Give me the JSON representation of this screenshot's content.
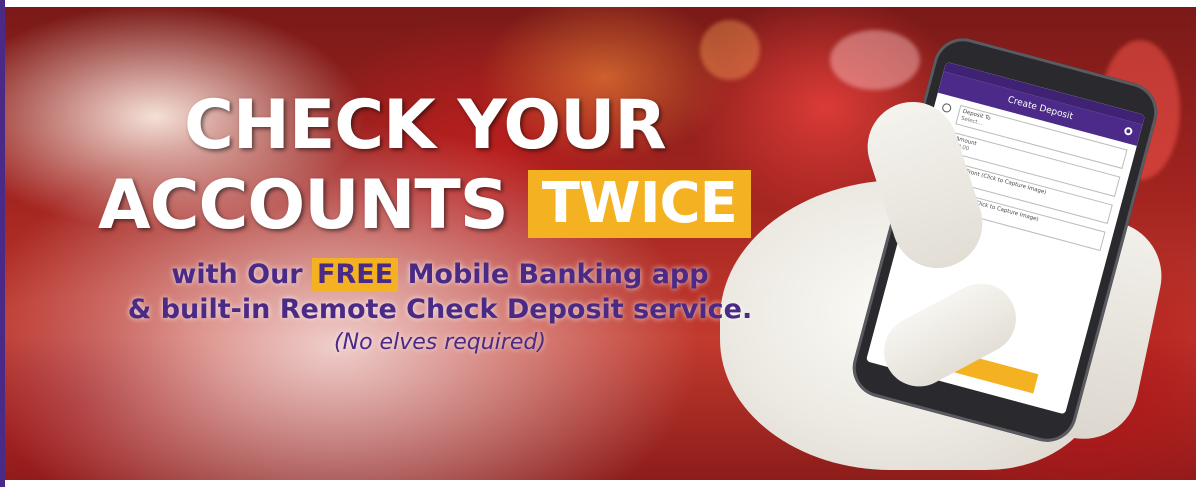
{
  "headline": {
    "line1": "CHECK YOUR",
    "line2_main": "ACCOUNTS",
    "line2_highlight": "TWICE"
  },
  "subtext": {
    "line1_before": "with Our",
    "line1_highlight": "FREE",
    "line1_after": "Mobile Banking app",
    "line2": "& built-in Remote Check Deposit service.",
    "line3": "(No elves required)"
  },
  "phone_screen": {
    "title": "Create Deposit",
    "fields": [
      {
        "label": "Deposit To",
        "value": "Select..."
      },
      {
        "label": "Amount",
        "value": "$0.00"
      },
      {
        "label": "Check Front (Click to Capture Image)",
        "value": ""
      },
      {
        "label": "Check Back (Click to Capture Image)",
        "value": ""
      }
    ]
  },
  "colors": {
    "purple": "#4b2a86",
    "gold": "#f4b223",
    "white": "#ffffff"
  },
  "icons": [
    "gear-icon",
    "radio-icon"
  ]
}
